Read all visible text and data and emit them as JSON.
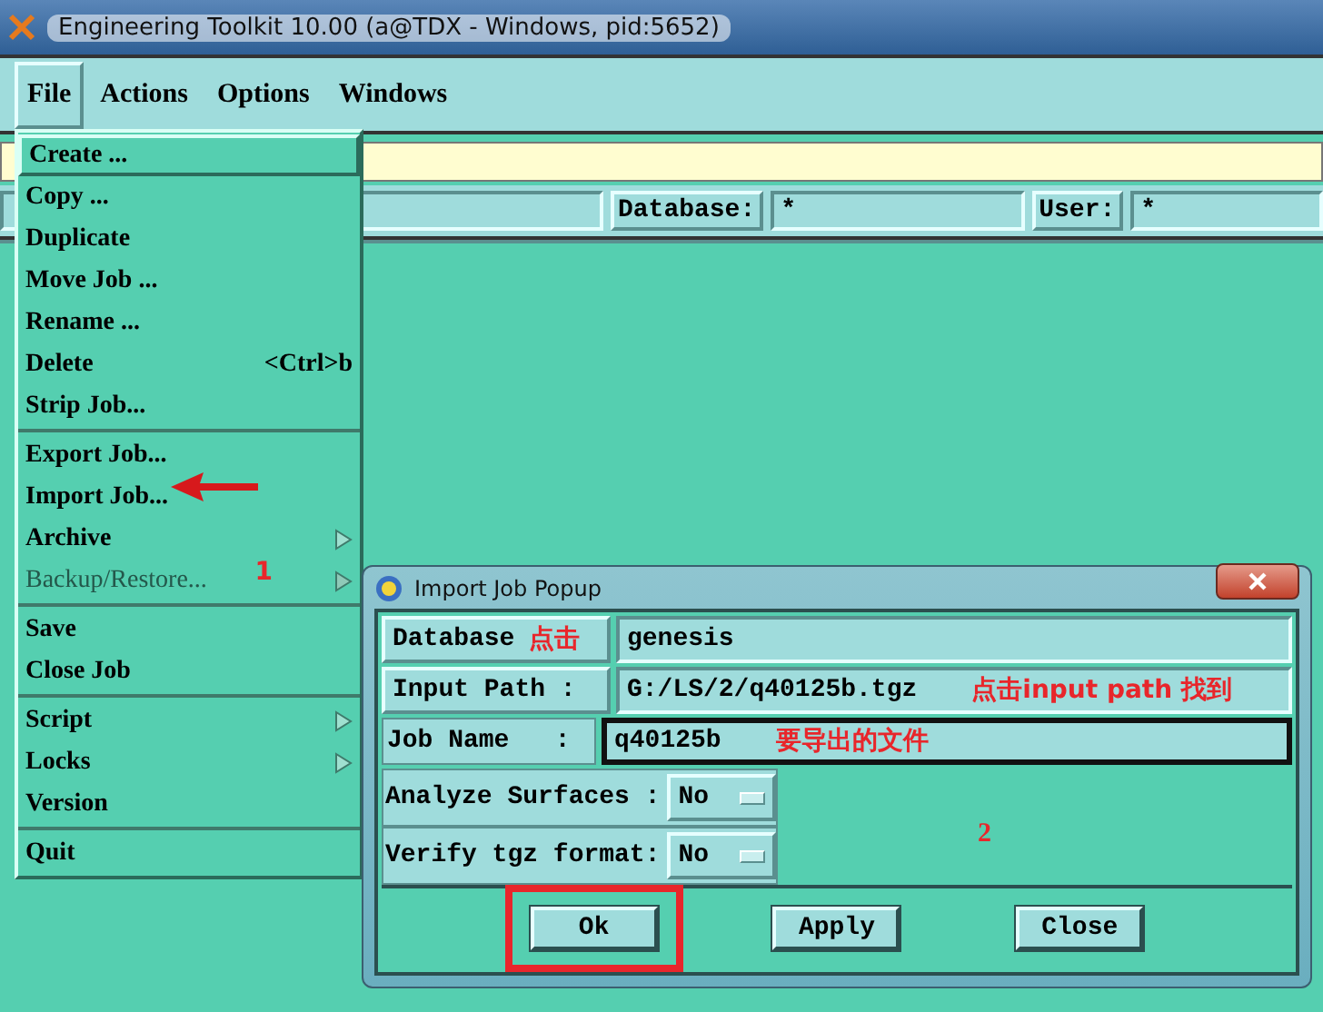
{
  "window": {
    "title": "Engineering Toolkit 10.00 (a@TDX - Windows, pid:5652)"
  },
  "menubar": [
    {
      "label": "File",
      "selected": true
    },
    {
      "label": "Actions",
      "selected": false
    },
    {
      "label": "Options",
      "selected": false
    },
    {
      "label": "Windows",
      "selected": false
    }
  ],
  "filter_row": {
    "database_label": "Database:",
    "database_value": "*",
    "user_label": "User:",
    "user_value": "*"
  },
  "file_menu": {
    "groups": [
      [
        {
          "label": "Create ...",
          "selected": true,
          "disabled": false,
          "submenu": false
        },
        {
          "label": "Copy ...",
          "selected": false,
          "disabled": false,
          "submenu": false
        },
        {
          "label": "Duplicate",
          "selected": false,
          "disabled": false,
          "submenu": false
        },
        {
          "label": "Move Job ...",
          "selected": false,
          "disabled": false,
          "submenu": false
        },
        {
          "label": "Rename ...",
          "selected": false,
          "disabled": false,
          "submenu": false
        },
        {
          "label": "Delete",
          "shortcut": "<Ctrl>b",
          "selected": false,
          "disabled": false,
          "submenu": false
        },
        {
          "label": "Strip Job...",
          "selected": false,
          "disabled": false,
          "submenu": false
        }
      ],
      [
        {
          "label": "Export Job...",
          "selected": false,
          "disabled": false,
          "submenu": false
        },
        {
          "label": "Import Job...",
          "selected": false,
          "disabled": false,
          "submenu": false
        },
        {
          "label": "Archive",
          "selected": false,
          "disabled": false,
          "submenu": true
        },
        {
          "label": "Backup/Restore...",
          "selected": false,
          "disabled": true,
          "submenu": true,
          "note": "1"
        }
      ],
      [
        {
          "label": "Save",
          "selected": false,
          "disabled": false,
          "submenu": false
        },
        {
          "label": "Close Job",
          "selected": false,
          "disabled": false,
          "submenu": false
        }
      ],
      [
        {
          "label": "Script",
          "selected": false,
          "disabled": false,
          "submenu": true
        },
        {
          "label": "Locks",
          "selected": false,
          "disabled": false,
          "submenu": true
        },
        {
          "label": "Version",
          "selected": false,
          "disabled": false,
          "submenu": false
        }
      ],
      [
        {
          "label": "Quit",
          "selected": false,
          "disabled": false,
          "submenu": false
        }
      ]
    ]
  },
  "popup": {
    "title": "Import Job Popup",
    "rows": [
      {
        "kind": "button_field",
        "label": "Database",
        "label_note": "点击",
        "value": "genesis"
      },
      {
        "kind": "button_field",
        "label": "Input Path :",
        "value": "G:/LS/2/q40125b.tgz",
        "note": "点击input path 找到"
      },
      {
        "kind": "label_field",
        "label": "Job Name   :",
        "value": "q40125b",
        "note": "要导出的文件"
      },
      {
        "kind": "option",
        "label": "Analyze Surfaces :",
        "value": "No"
      },
      {
        "kind": "option",
        "label": "Verify tgz format:",
        "value": "No"
      }
    ],
    "note": "2",
    "buttons": [
      {
        "label": "Ok",
        "highlighted": true
      },
      {
        "label": "Apply",
        "highlighted": false
      },
      {
        "label": "Close",
        "highlighted": false
      }
    ]
  }
}
